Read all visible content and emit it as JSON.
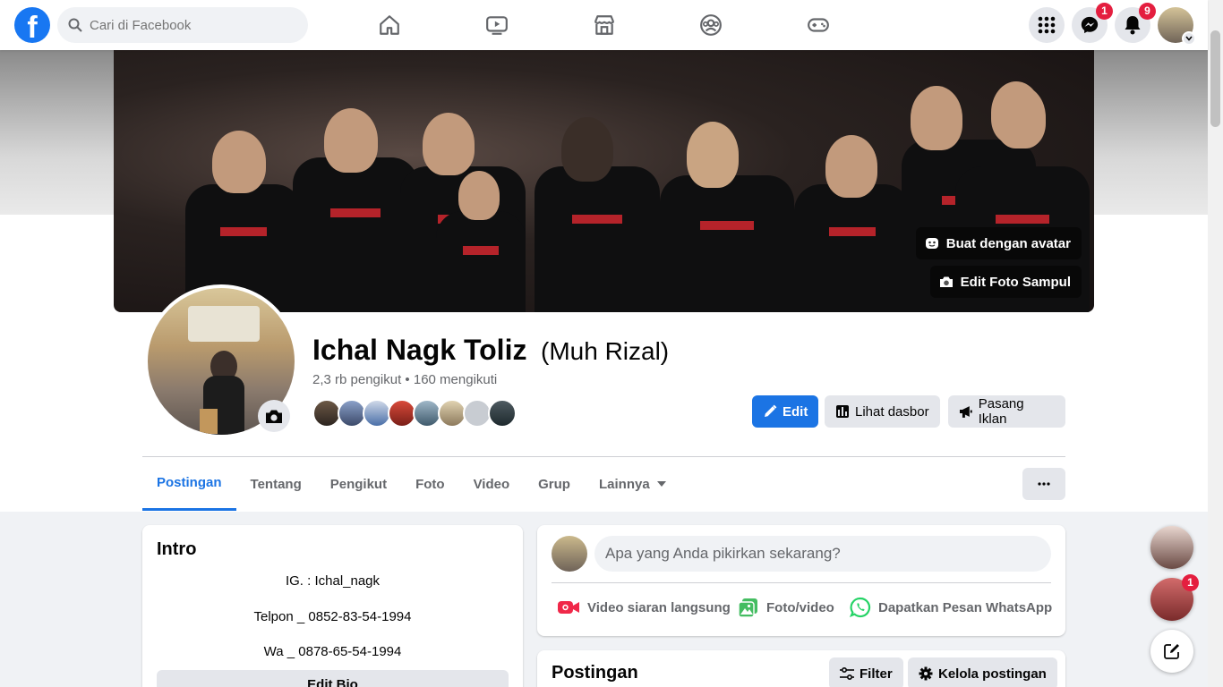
{
  "topbar": {
    "logo": "f",
    "search_placeholder": "Cari di Facebook",
    "nav_icons": [
      "home-icon",
      "watch-icon",
      "marketplace-icon",
      "groups-icon",
      "gaming-icon"
    ],
    "messenger_badge": "1",
    "notifications_badge": "9"
  },
  "cover": {
    "avatar_btn": "Buat dengan avatar",
    "edit_cover_btn": "Edit Foto Sampul"
  },
  "profile": {
    "name": "Ichal Nagk Toliz",
    "alt_name": "(Muh Rizal)",
    "followers": "2,3 rb pengikut",
    "separator": "•",
    "following": "160 mengikuti"
  },
  "actions": {
    "edit": "Edit",
    "dashboard": "Lihat dasbor",
    "ads": "Pasang Iklan"
  },
  "tabs": [
    {
      "label": "Postingan"
    },
    {
      "label": "Tentang"
    },
    {
      "label": "Pengikut"
    },
    {
      "label": "Foto"
    },
    {
      "label": "Video"
    },
    {
      "label": "Grup"
    },
    {
      "label": "Lainnya"
    }
  ],
  "intro": {
    "title": "Intro",
    "bio": [
      "IG. : Ichal_nagk",
      "Telpon _ 0852-83-54-1994",
      "Wa _ 0878-65-54-1994"
    ],
    "edit_bio": "Edit Bio"
  },
  "composer": {
    "placeholder": "Apa yang Anda pikirkan sekarang?",
    "live": "Video siaran langsung",
    "photo": "Foto/video",
    "whatsapp": "Dapatkan Pesan WhatsApp"
  },
  "posts": {
    "title": "Postingan",
    "filter": "Filter",
    "manage": "Kelola postingan"
  },
  "chat": {
    "badge": "1"
  },
  "colors": {
    "brand": "#1877f2",
    "primary_button": "#1b74e4",
    "badge": "#e41e3f"
  }
}
